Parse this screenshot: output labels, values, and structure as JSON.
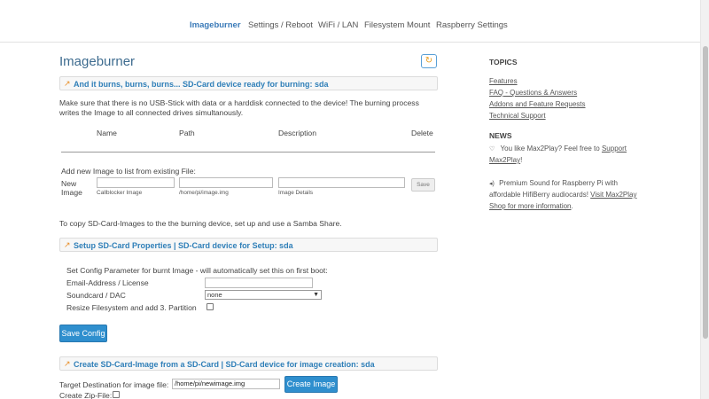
{
  "nav": {
    "items": [
      "Imageburner",
      "Settings / Reboot",
      "WiFi / LAN",
      "Filesystem Mount",
      "Raspberry Settings"
    ]
  },
  "main": {
    "title": "Imageburner",
    "refresh_icon": "refresh-icon",
    "burn_panel": "And it burns, burns, burns... SD-Card device ready for burning: sda",
    "intro_line1": "Make sure that there is no USB-Stick with data or a harddisk connected to the device! The burning process",
    "intro_line2": "writes the Image to all connected drives simultanously.",
    "table": {
      "headers": [
        "Name",
        "Path",
        "Description",
        "Delete"
      ]
    },
    "add_label": "Add new Image to list from existing File:",
    "new_image_label1": "New",
    "new_image_label2": "Image",
    "inputs": {
      "name_hint": "Callblocker Image",
      "path_hint": "/home/pi/image.img",
      "desc_hint": "Image Details",
      "save_label": "Save"
    },
    "samba_note": "To copy SD-Card-Images to the the burning device, set up and use a Samba Share.",
    "setup_panel": "Setup SD-Card Properties | SD-Card device for Setup: sda",
    "config_intro": "Set Config Parameter for burnt Image - will automatically set this on first boot:",
    "email_label": "Email-Address / License",
    "soundcard_label": "Soundcard / DAC",
    "soundcard_value": "none",
    "resize_label": "Resize Filesystem and add 3. Partition",
    "save_config_label": "Save Config",
    "create_panel": "Create SD-Card-Image from a SD-Card | SD-Card device for image creation: sda",
    "target_label": "Target Destination for image file:",
    "target_value": "/home/pi/newimage.img",
    "create_button": "Create Image",
    "zip_label": "Create Zip-File:"
  },
  "sidebar": {
    "topics_title": "TOPICS",
    "topics": [
      "Features",
      "FAQ - Questions & Answers",
      "Addons and Feature Requests",
      "Technical Support"
    ],
    "news_title": "NEWS",
    "news1_line1": "You like Max2Play? Feel free to ",
    "news1_link1": "Support",
    "news1_link2": "Max2Play",
    "news1_end": "!",
    "news2_line1": "Premium Sound for Raspberry Pi with",
    "news2_line2": "affordable HifiBerry audiocards! ",
    "news2_link1": "Visit Max2Play",
    "news2_link2": "Shop for more information",
    "news2_end": "."
  },
  "colors": {
    "accent": "#2f8fce",
    "panel_title": "#2f7fb8",
    "icon_orange": "#e8902a"
  }
}
